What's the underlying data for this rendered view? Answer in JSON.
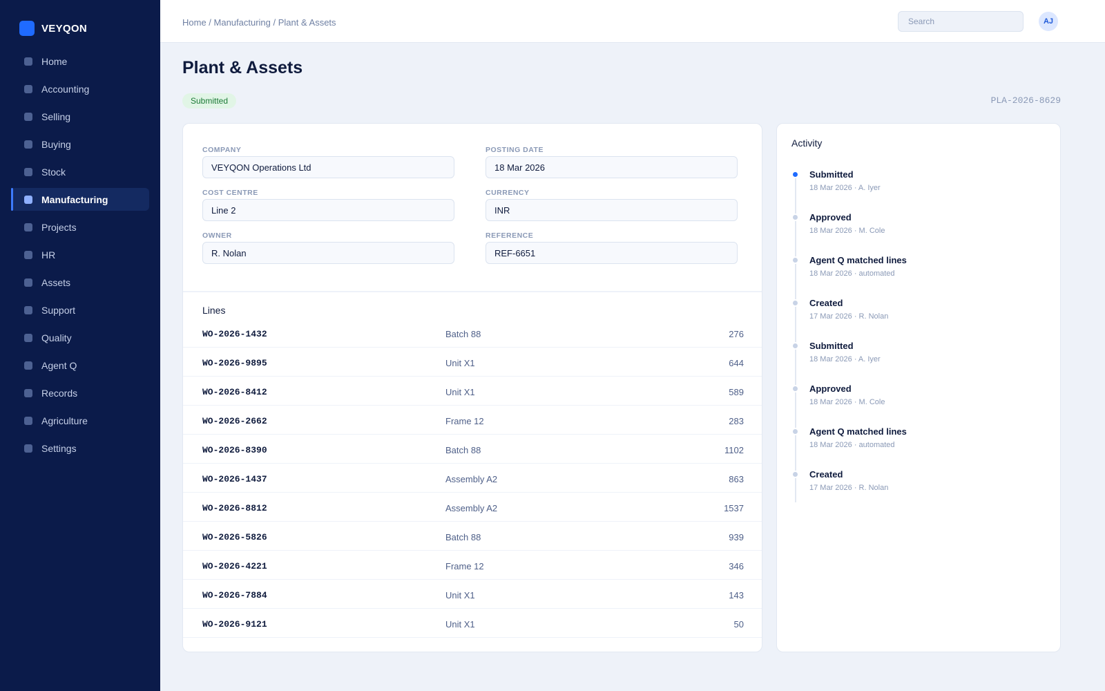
{
  "app": {
    "name": "VEYQON"
  },
  "sidebar": {
    "items": [
      {
        "label": "Home"
      },
      {
        "label": "Accounting"
      },
      {
        "label": "Selling"
      },
      {
        "label": "Buying"
      },
      {
        "label": "Stock"
      },
      {
        "label": "Manufacturing",
        "active": true
      },
      {
        "label": "Projects"
      },
      {
        "label": "HR"
      },
      {
        "label": "Assets"
      },
      {
        "label": "Support"
      },
      {
        "label": "Quality"
      },
      {
        "label": "Agent Q"
      },
      {
        "label": "Records"
      },
      {
        "label": "Agriculture"
      },
      {
        "label": "Settings"
      }
    ]
  },
  "header": {
    "breadcrumb": "Home / Manufacturing / Plant & Assets",
    "search_placeholder": "Search",
    "avatar_initials": "AJ"
  },
  "page": {
    "title": "Plant & Assets",
    "status": "Submitted",
    "doc_id": "PLA-2026-8629"
  },
  "form": {
    "company": {
      "label": "COMPANY",
      "value": "VEYQON Operations Ltd"
    },
    "posting_date": {
      "label": "POSTING DATE",
      "value": "18 Mar 2026"
    },
    "cost_centre": {
      "label": "COST CENTRE",
      "value": "Line 2"
    },
    "currency": {
      "label": "CURRENCY",
      "value": "INR"
    },
    "owner": {
      "label": "OWNER",
      "value": "R. Nolan"
    },
    "reference": {
      "label": "REFERENCE",
      "value": "REF-6651"
    }
  },
  "lines": {
    "title": "Lines",
    "rows": [
      {
        "id": "WO-2026-1432",
        "item": "Batch 88",
        "qty": "276"
      },
      {
        "id": "WO-2026-9895",
        "item": "Unit X1",
        "qty": "644"
      },
      {
        "id": "WO-2026-8412",
        "item": "Unit X1",
        "qty": "589"
      },
      {
        "id": "WO-2026-2662",
        "item": "Frame 12",
        "qty": "283"
      },
      {
        "id": "WO-2026-8390",
        "item": "Batch 88",
        "qty": "1102"
      },
      {
        "id": "WO-2026-1437",
        "item": "Assembly A2",
        "qty": "863"
      },
      {
        "id": "WO-2026-8812",
        "item": "Assembly A2",
        "qty": "1537"
      },
      {
        "id": "WO-2026-5826",
        "item": "Batch 88",
        "qty": "939"
      },
      {
        "id": "WO-2026-4221",
        "item": "Frame 12",
        "qty": "346"
      },
      {
        "id": "WO-2026-7884",
        "item": "Unit X1",
        "qty": "143"
      },
      {
        "id": "WO-2026-9121",
        "item": "Unit X1",
        "qty": "50"
      }
    ]
  },
  "activity": {
    "title": "Activity",
    "events": [
      {
        "title": "Submitted",
        "meta": "18 Mar 2026 · A. Iyer",
        "current": true
      },
      {
        "title": "Approved",
        "meta": "18 Mar 2026 · M. Cole"
      },
      {
        "title": "Agent Q matched lines",
        "meta": "18 Mar 2026 · automated"
      },
      {
        "title": "Created",
        "meta": "17 Mar 2026 · R. Nolan"
      },
      {
        "title": "Submitted",
        "meta": "18 Mar 2026 · A. Iyer"
      },
      {
        "title": "Approved",
        "meta": "18 Mar 2026 · M. Cole"
      },
      {
        "title": "Agent Q matched lines",
        "meta": "18 Mar 2026 · automated"
      },
      {
        "title": "Created",
        "meta": "17 Mar 2026 · R. Nolan"
      }
    ]
  },
  "colors": {
    "sidebar_bg": "#0b1b4a",
    "accent": "#1f6bff",
    "page_bg": "#eef2f9",
    "status_bg": "#e1f5e6",
    "status_text": "#1b7a36"
  }
}
